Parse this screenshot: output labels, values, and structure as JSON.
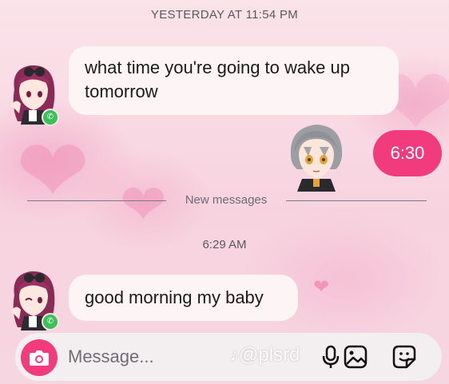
{
  "chat": {
    "timestamp_1": "YESTERDAY AT 11:54 PM",
    "message_1": "what time you're going to wake up tomorrow",
    "message_2": "6:30",
    "new_messages_label": "New messages",
    "timestamp_2": "6:29 AM",
    "message_3": "good morning my baby"
  },
  "composer": {
    "placeholder": "Message...",
    "watermark": "♪@plsrd"
  },
  "icons": {
    "camera": "camera-icon",
    "microphone": "microphone-icon",
    "gallery": "image-icon",
    "sticker": "sticker-icon",
    "call": "phone-icon"
  },
  "colors": {
    "accent": "#f13b7c",
    "incoming_bubble": "#fdf4f6",
    "call_badge": "#3cc15a"
  }
}
